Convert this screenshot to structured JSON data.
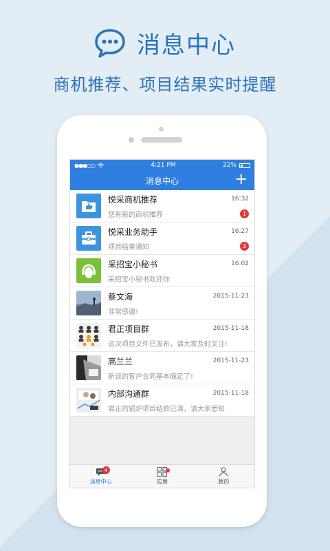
{
  "hero": {
    "title": "消息中心",
    "subtitle": "商机推荐、项目结果实时提醒"
  },
  "status_bar": {
    "signal": "●●●○○",
    "time": "4:21 PM",
    "battery": "22%"
  },
  "nav": {
    "title": "消息中心",
    "add_label": "+"
  },
  "messages": [
    {
      "name": "悦采商机推荐",
      "time": "16:32",
      "preview": "您有新的商机推荐",
      "badge": "1",
      "avatar": "folder-thumbs-icon"
    },
    {
      "name": "悦采业务助手",
      "time": "16:27",
      "preview": "项目结果通知",
      "badge": "3",
      "avatar": "briefcase-icon"
    },
    {
      "name": "采招宝小秘书",
      "time": "16:02",
      "preview": "采招宝小秘书欢迎你",
      "badge": "",
      "avatar": "headset-icon"
    },
    {
      "name": "蔡文海",
      "time": "2015-11-23",
      "preview": "非常感谢!",
      "badge": "",
      "avatar": "photo-avatar"
    },
    {
      "name": "君正项目群",
      "time": "2015-11-18",
      "preview": "这次项目文件已发布，请大家及时关注!",
      "badge": "",
      "avatar": "group-avatar"
    },
    {
      "name": "高兰兰",
      "time": "2015-11-23",
      "preview": "新谈的客户合同基本确定了!",
      "badge": "",
      "avatar": "photo-avatar"
    },
    {
      "name": "内部沟通群",
      "time": "2015-11-18",
      "preview": "君正的锅炉项目结款已清，请大家悉知",
      "badge": "",
      "avatar": "group-avatar"
    }
  ],
  "tabs": [
    {
      "label": "消息中心",
      "badge": "4"
    },
    {
      "label": "应用"
    },
    {
      "label": "我的"
    }
  ],
  "colors": {
    "accent": "#2f7fe0",
    "hero_text": "#2a72b9",
    "badge": "#e03b3b"
  }
}
